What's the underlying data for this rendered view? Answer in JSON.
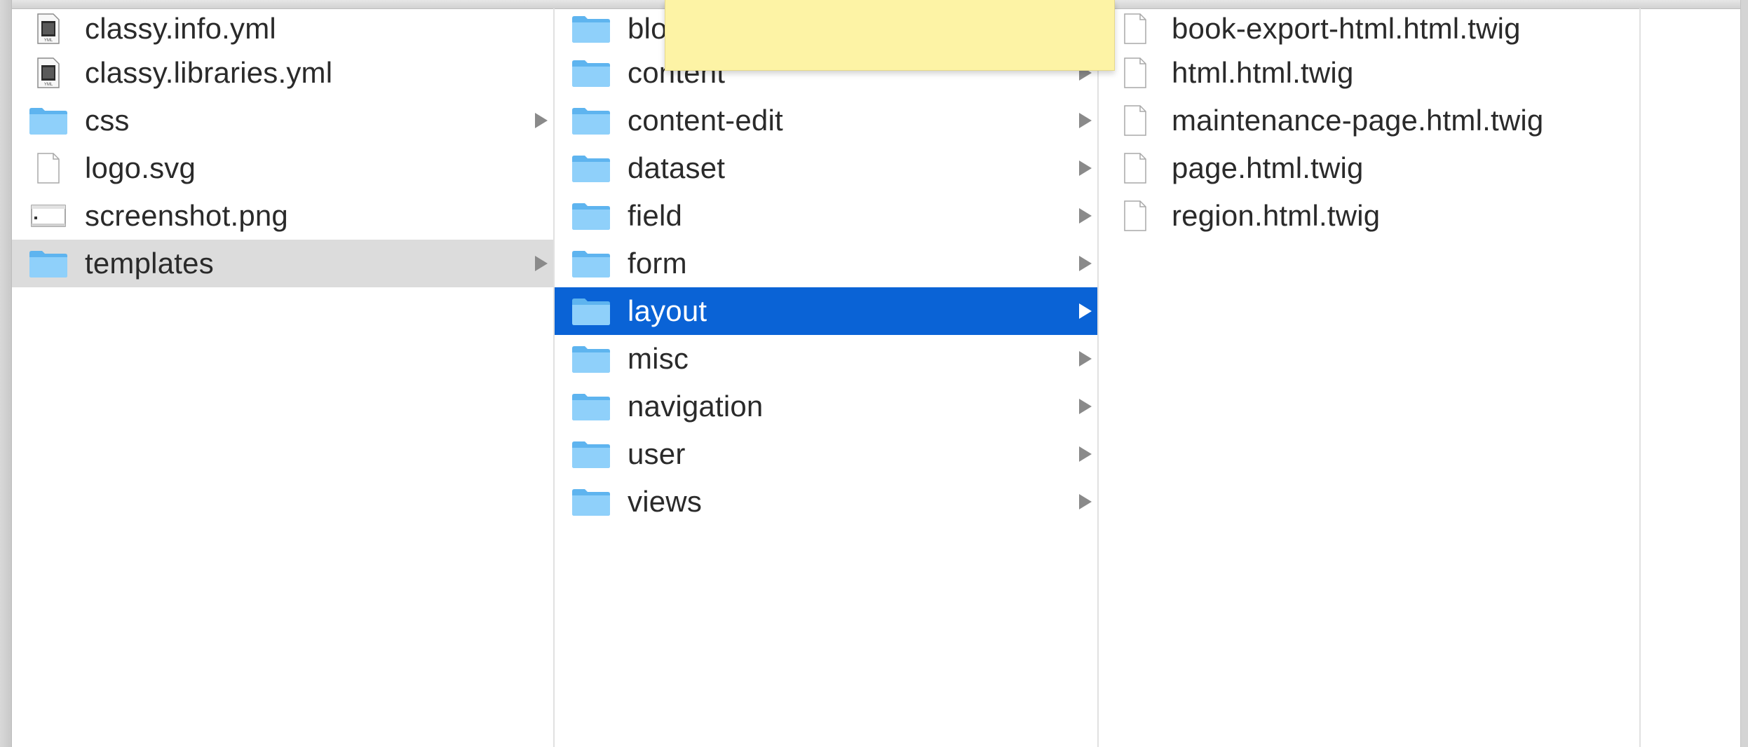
{
  "columns": {
    "col1": [
      {
        "label": "classy.info.yml",
        "icon": "yml-document-icon"
      },
      {
        "label": "classy.libraries.yml",
        "icon": "yml-document-icon"
      },
      {
        "label": "css",
        "icon": "folder-icon"
      },
      {
        "label": "logo.svg",
        "icon": "blank-document-icon"
      },
      {
        "label": "screenshot.png",
        "icon": "image-document-icon"
      },
      {
        "label": "templates",
        "icon": "folder-icon"
      }
    ],
    "col2": [
      {
        "label": "blo",
        "icon": "folder-icon"
      },
      {
        "label": "content",
        "icon": "folder-icon"
      },
      {
        "label": "content-edit",
        "icon": "folder-icon"
      },
      {
        "label": "dataset",
        "icon": "folder-icon"
      },
      {
        "label": "field",
        "icon": "folder-icon"
      },
      {
        "label": "form",
        "icon": "folder-icon"
      },
      {
        "label": "layout",
        "icon": "folder-icon"
      },
      {
        "label": "misc",
        "icon": "folder-icon"
      },
      {
        "label": "navigation",
        "icon": "folder-icon"
      },
      {
        "label": "user",
        "icon": "folder-icon"
      },
      {
        "label": "views",
        "icon": "folder-icon"
      }
    ],
    "col3": [
      {
        "label": "book-export-html.html.twig",
        "icon": "blank-document-icon"
      },
      {
        "label": "html.html.twig",
        "icon": "blank-document-icon"
      },
      {
        "label": "maintenance-page.html.twig",
        "icon": "blank-document-icon"
      },
      {
        "label": "page.html.twig",
        "icon": "blank-document-icon"
      },
      {
        "label": "region.html.twig",
        "icon": "blank-document-icon"
      }
    ]
  },
  "colors": {
    "selection_active": "#0a63d6",
    "selection_inactive": "#dcdcdc",
    "folder": "#7cc6f6",
    "sticky_note": "#fdf3a5"
  }
}
